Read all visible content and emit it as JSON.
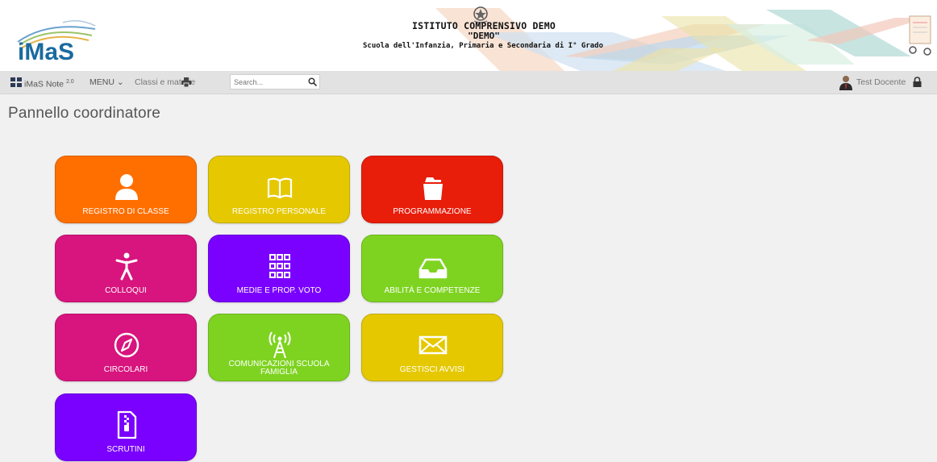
{
  "header": {
    "logo_text": "iMaS",
    "school_name": "ISTITUTO COMPRENSIVO DEMO",
    "school_code": "\"DEMO\"",
    "school_desc": "Scuola dell'Infanzia, Primaria e Secondaria di I° Grado"
  },
  "toolbar": {
    "brand": "iMaS Note",
    "brand_version": "2.0",
    "menu_label": "MENU ⌄",
    "classi_label": "Classi e materie",
    "search_placeholder": "Search...",
    "user_name": "Test Docente"
  },
  "page": {
    "title": "Pannello coordinatore"
  },
  "tiles": [
    {
      "label": "REGISTRO DI CLASSE",
      "color": "#ff6f00",
      "icon": "user-icon"
    },
    {
      "label": "REGISTRO PERSONALE",
      "color": "#e5c800",
      "icon": "book-icon"
    },
    {
      "label": "PROGRAMMAZIONE",
      "color": "#e81d0a",
      "icon": "folder-icon"
    },
    {
      "label": "COLLOQUI",
      "color": "#d8147e",
      "icon": "person-icon"
    },
    {
      "label": "MEDIE E PROP. VOTO",
      "color": "#7a00ff",
      "icon": "grid-icon"
    },
    {
      "label": "ABILITÁ E COMPETENZE",
      "color": "#7ed321",
      "icon": "inbox-icon"
    },
    {
      "label": "CIRCOLARI",
      "color": "#d8147e",
      "icon": "compass-icon"
    },
    {
      "label": "COMUNICAZIONI SCUOLA FAMIGLIA",
      "color": "#7ed321",
      "icon": "broadcast-icon"
    },
    {
      "label": "GESTISCI AVVISI",
      "color": "#e5c800",
      "icon": "envelope-icon"
    },
    {
      "label": "SCRUTINI",
      "color": "#7a00ff",
      "icon": "zip-file-icon"
    }
  ]
}
